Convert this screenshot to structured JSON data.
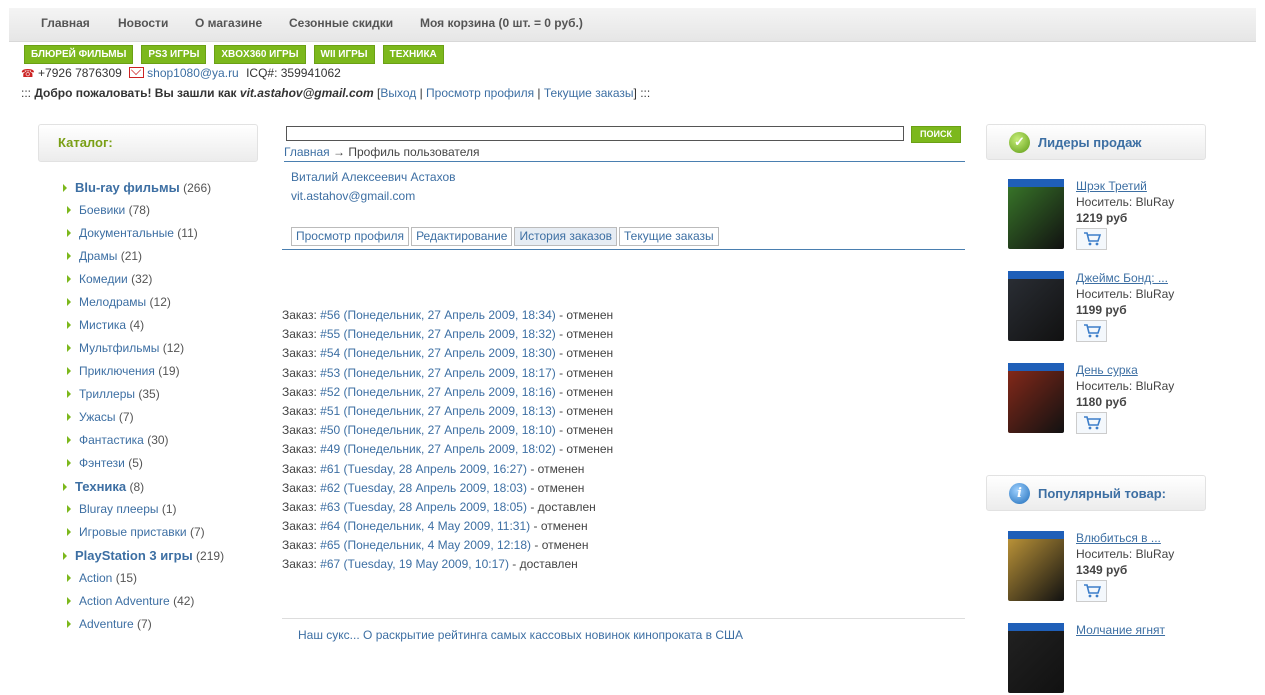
{
  "topnav": [
    "Главная",
    "Новости",
    "О магазине",
    "Сезонные скидки",
    "Моя корзина (0 шт. = 0 руб.)"
  ],
  "categories_bar": [
    "БЛЮРЕЙ ФИЛЬМЫ",
    "PS3 ИГРЫ",
    "XBOX360 ИГРЫ",
    "WII ИГРЫ",
    "ТЕХНИКА"
  ],
  "contacts": {
    "phone": "+7926 7876309",
    "email": "shop1080@ya.ru",
    "icq": "ICQ#: 359941062"
  },
  "welcome": {
    "prefix": ":::",
    "text": "Добро пожаловать! Вы зашли как",
    "user": "vit.astahov@gmail.com",
    "links": [
      "Выход",
      "Просмотр профиля",
      "Текущие заказы"
    ],
    "suffix": ":::"
  },
  "catalog": {
    "title": "Каталог:",
    "items": [
      {
        "name": "Blu-ray фильмы",
        "count": "(266)",
        "level": 0
      },
      {
        "name": "Боевики",
        "count": "(78)",
        "level": 1
      },
      {
        "name": "Документальные",
        "count": "(11)",
        "level": 1
      },
      {
        "name": "Драмы",
        "count": "(21)",
        "level": 1
      },
      {
        "name": "Комедии",
        "count": "(32)",
        "level": 1
      },
      {
        "name": "Мелодрамы",
        "count": "(12)",
        "level": 1
      },
      {
        "name": "Мистика",
        "count": "(4)",
        "level": 1
      },
      {
        "name": "Мультфильмы",
        "count": "(12)",
        "level": 1
      },
      {
        "name": "Приключения",
        "count": "(19)",
        "level": 1
      },
      {
        "name": "Триллеры",
        "count": "(35)",
        "level": 1
      },
      {
        "name": "Ужасы",
        "count": "(7)",
        "level": 1
      },
      {
        "name": "Фантастика",
        "count": "(30)",
        "level": 1
      },
      {
        "name": "Фэнтези",
        "count": "(5)",
        "level": 1
      },
      {
        "name": "Техника",
        "count": "(8)",
        "level": 0
      },
      {
        "name": "Bluray плееры",
        "count": "(1)",
        "level": 1
      },
      {
        "name": "Игровые приставки",
        "count": "(7)",
        "level": 1
      },
      {
        "name": "PlayStation 3 игры",
        "count": "(219)",
        "level": 0
      },
      {
        "name": "Action",
        "count": "(15)",
        "level": 1
      },
      {
        "name": "Action Adventure",
        "count": "(42)",
        "level": 1
      },
      {
        "name": "Adventure",
        "count": "(7)",
        "level": 1
      }
    ]
  },
  "search": {
    "button": "ПОИСК",
    "value": ""
  },
  "breadcrumb": {
    "home": "Главная",
    "sep": "→",
    "current": "Профиль пользователя"
  },
  "profile": {
    "name": "Виталий Алексеевич Астахов",
    "email": "vit.astahov@gmail.com"
  },
  "tabs": [
    "Просмотр профиля",
    "Редактирование",
    "История заказов",
    "Текущие заказы"
  ],
  "orders": {
    "label": "Заказ:",
    "items": [
      {
        "id": "#56 (Понедельник, 27 Апрель 2009, 18:34)",
        "status": "отменен"
      },
      {
        "id": "#55 (Понедельник, 27 Апрель 2009, 18:32)",
        "status": "отменен"
      },
      {
        "id": "#54 (Понедельник, 27 Апрель 2009, 18:30)",
        "status": "отменен"
      },
      {
        "id": "#53 (Понедельник, 27 Апрель 2009, 18:17)",
        "status": "отменен"
      },
      {
        "id": "#52 (Понедельник, 27 Апрель 2009, 18:16)",
        "status": "отменен"
      },
      {
        "id": "#51 (Понедельник, 27 Апрель 2009, 18:13)",
        "status": "отменен"
      },
      {
        "id": "#50 (Понедельник, 27 Апрель 2009, 18:10)",
        "status": "отменен"
      },
      {
        "id": "#49 (Понедельник, 27 Апрель 2009, 18:02)",
        "status": "отменен"
      },
      {
        "id": "#61 (Tuesday, 28 Апрель 2009, 16:27)",
        "status": "отменен"
      },
      {
        "id": "#62 (Tuesday, 28 Апрель 2009, 18:03)",
        "status": "отменен"
      },
      {
        "id": "#63 (Tuesday, 28 Апрель 2009, 18:05)",
        "status": "доставлен"
      },
      {
        "id": "#64 (Понедельник, 4 May 2009, 11:31)",
        "status": "отменен"
      },
      {
        "id": "#65 (Понедельник, 4 May 2009, 12:18)",
        "status": "отменен"
      },
      {
        "id": "#67 (Tuesday, 19 May 2009, 10:17)",
        "status": "доставлен"
      }
    ]
  },
  "bottom_news": "Наш сукс... О раскрытие рейтинга самых кассовых новинок кинопроката в США",
  "bestsellers": {
    "title": "Лидеры продаж",
    "items": [
      {
        "title": "Шрэк Третий",
        "media": "Носитель: BluRay",
        "price": "1219 руб",
        "cover": "#3a7a2a"
      },
      {
        "title": "Джеймс Бонд: ...",
        "media": "Носитель: BluRay",
        "price": "1199 руб",
        "cover": "#2b2f36"
      },
      {
        "title": "День сурка",
        "media": "Носитель: BluRay",
        "price": "1180 руб",
        "cover": "#8a2a1a"
      }
    ]
  },
  "popular": {
    "title": "Популярный товар:",
    "items": [
      {
        "title": "Влюбиться в ...",
        "media": "Носитель: BluRay",
        "price": "1349 руб",
        "cover": "#c49a3a"
      },
      {
        "title": "Молчание ягнят",
        "media": "",
        "price": "",
        "cover": "#222"
      }
    ]
  },
  "colors": {
    "accent_green": "#7cb81c",
    "link_blue": "#3d6fa3"
  }
}
